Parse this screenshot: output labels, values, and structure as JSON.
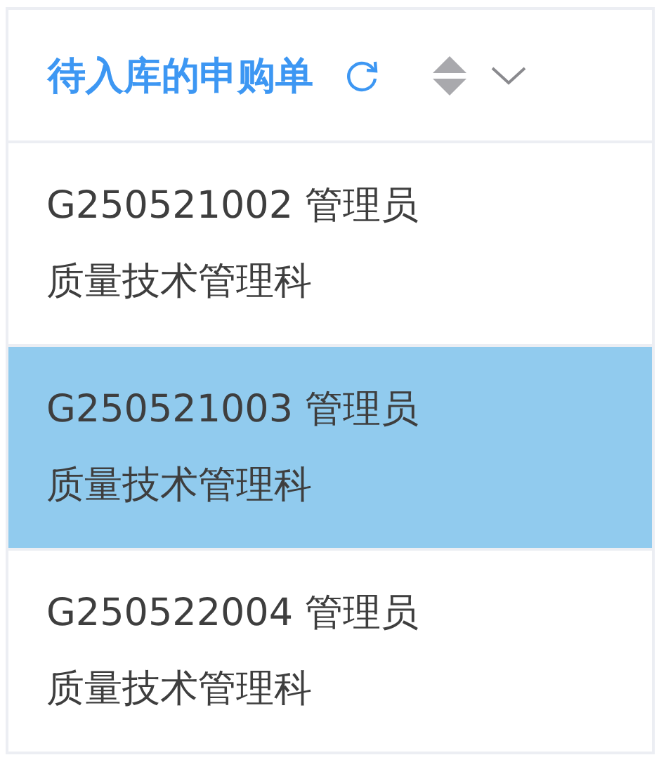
{
  "header": {
    "title": "待入库的申购单"
  },
  "orders": [
    {
      "line_1": "G250521002 管理员",
      "line_2": "质量技术管理科",
      "selected": false
    },
    {
      "line_1": "G250521003 管理员",
      "line_2": "质量技术管理科",
      "selected": true
    },
    {
      "line_1": "G250522004 管理员",
      "line_2": "质量技术管理科",
      "selected": false
    }
  ]
}
